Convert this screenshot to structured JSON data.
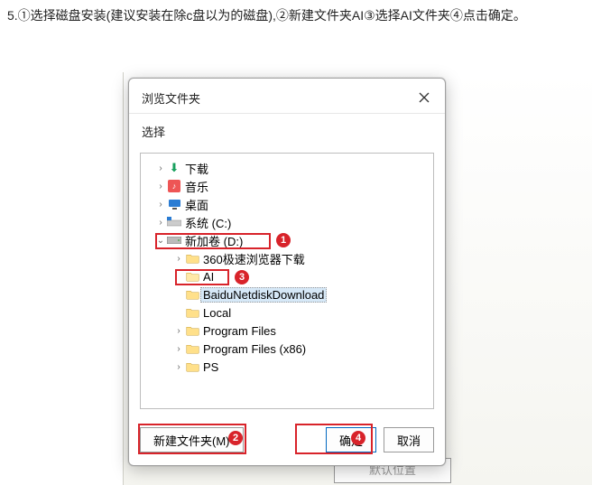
{
  "instruction": "5.①选择磁盘安装(建议安装在除c盘以为的磁盘),②新建文件夹AI③选择AI文件夹④点击确定。",
  "dialog": {
    "title": "浏览文件夹",
    "prompt": "选择",
    "buttons": {
      "new_folder": "新建文件夹(M)",
      "ok": "确定",
      "cancel": "取消"
    }
  },
  "tree": {
    "items": [
      {
        "level": 0,
        "expander": "›",
        "icon": "download",
        "label": "下载"
      },
      {
        "level": 0,
        "expander": "›",
        "icon": "music",
        "label": "音乐"
      },
      {
        "level": 0,
        "expander": "›",
        "icon": "desktop",
        "label": "桌面"
      },
      {
        "level": 0,
        "expander": "›",
        "icon": "sysdrive",
        "label": "系统 (C:)"
      },
      {
        "level": 0,
        "expander": "⌄",
        "icon": "drive",
        "label": "新加卷 (D:)"
      },
      {
        "level": 1,
        "expander": "›",
        "icon": "folder",
        "label": "360极速浏览器下载"
      },
      {
        "level": 1,
        "expander": "",
        "icon": "folder-open",
        "label": "AI",
        "selected": false
      },
      {
        "level": 1,
        "expander": "",
        "icon": "folder",
        "label": "BaiduNetdiskDownload",
        "selected": true
      },
      {
        "level": 1,
        "expander": "",
        "icon": "folder",
        "label": "Local"
      },
      {
        "level": 1,
        "expander": "›",
        "icon": "folder",
        "label": "Program Files"
      },
      {
        "level": 1,
        "expander": "›",
        "icon": "folder",
        "label": "Program Files (x86)"
      },
      {
        "level": 1,
        "expander": "›",
        "icon": "folder",
        "label": "PS"
      }
    ]
  },
  "callouts": {
    "1": "1",
    "2": "2",
    "3": "3",
    "4": "4"
  },
  "background": {
    "secondary_button": "默认位置"
  }
}
